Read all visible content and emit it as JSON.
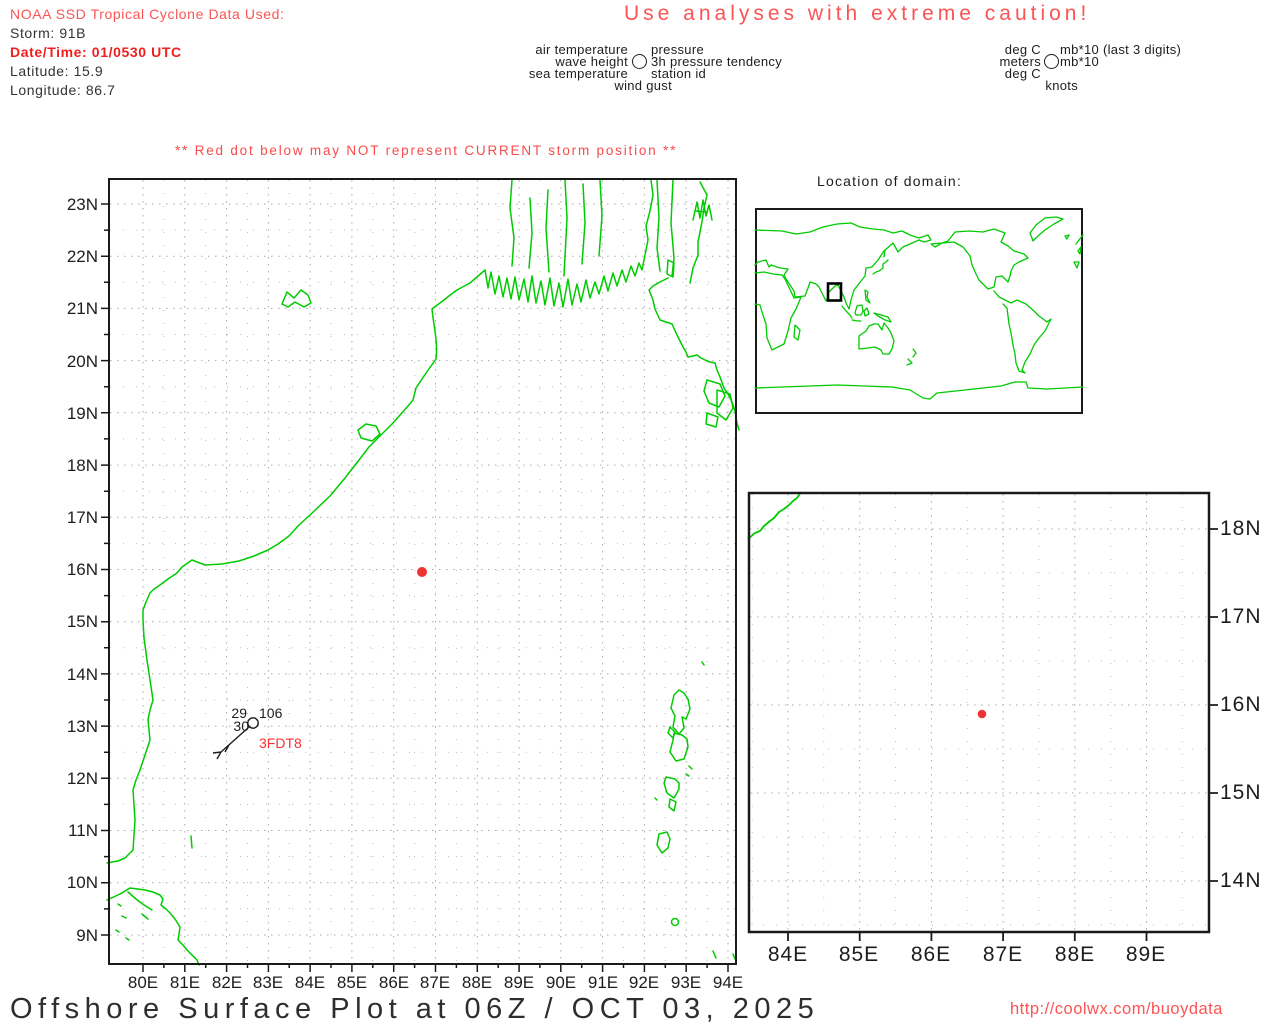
{
  "header": {
    "source_line": "NOAA SSD Tropical Cyclone Data Used:",
    "storm": "Storm: 91B",
    "datetime": "Date/Time: 01/0530 UTC",
    "latitude": "Latitude: 15.9",
    "longitude": "Longitude: 86.7"
  },
  "caution": "Use analyses with extreme caution!",
  "warning": "** Red dot below may NOT represent CURRENT storm position **",
  "station_legend": {
    "air_temperature": "air temperature",
    "wave_height": "wave height",
    "sea_temperature": "sea temperature",
    "wind_gust": "wind gust",
    "pressure": "pressure",
    "pressure_tendency": "3h pressure tendency",
    "station_id": "station id"
  },
  "units_legend": {
    "air_temperature": "deg C",
    "wave_height": "meters",
    "sea_temperature": "deg C",
    "wind_gust": "knots",
    "pressure": "mb*10 (last 3 digits)",
    "pressure_tendency": "mb*10"
  },
  "domain_inset": {
    "title": "Location of domain:"
  },
  "main_map": {
    "x_ticks": [
      "80E",
      "81E",
      "82E",
      "83E",
      "84E",
      "85E",
      "86E",
      "87E",
      "88E",
      "89E",
      "90E",
      "91E",
      "92E",
      "93E",
      "94E"
    ],
    "y_ticks": [
      "23N",
      "22N",
      "21N",
      "20N",
      "19N",
      "18N",
      "17N",
      "16N",
      "15N",
      "14N",
      "13N",
      "12N",
      "11N",
      "10N",
      "9N"
    ],
    "station": {
      "air_temp": "29",
      "sea_temp": "30",
      "pressure": "106",
      "id": "3FDT8"
    },
    "storm_position": {
      "lon": 86.7,
      "lat": 15.9
    }
  },
  "zoom_map": {
    "x_ticks": [
      "84E",
      "85E",
      "86E",
      "87E",
      "88E",
      "89E"
    ],
    "y_ticks": [
      "18N",
      "17N",
      "16N",
      "15N",
      "14N"
    ],
    "storm_position": {
      "lon": 86.7,
      "lat": 15.9
    }
  },
  "footer": {
    "title": "Offshore Surface Plot at 06Z / OCT 03, 2025",
    "url": "http://coolwx.com/buoydata"
  },
  "colors": {
    "coastline_green": "#00cb00",
    "grid_gray": "#a9a9a9",
    "coral_red": "#fb5454",
    "alert_red": "#f21d1d",
    "storm_dot_red": "#ee3333",
    "station_id_red": "#f83030"
  }
}
